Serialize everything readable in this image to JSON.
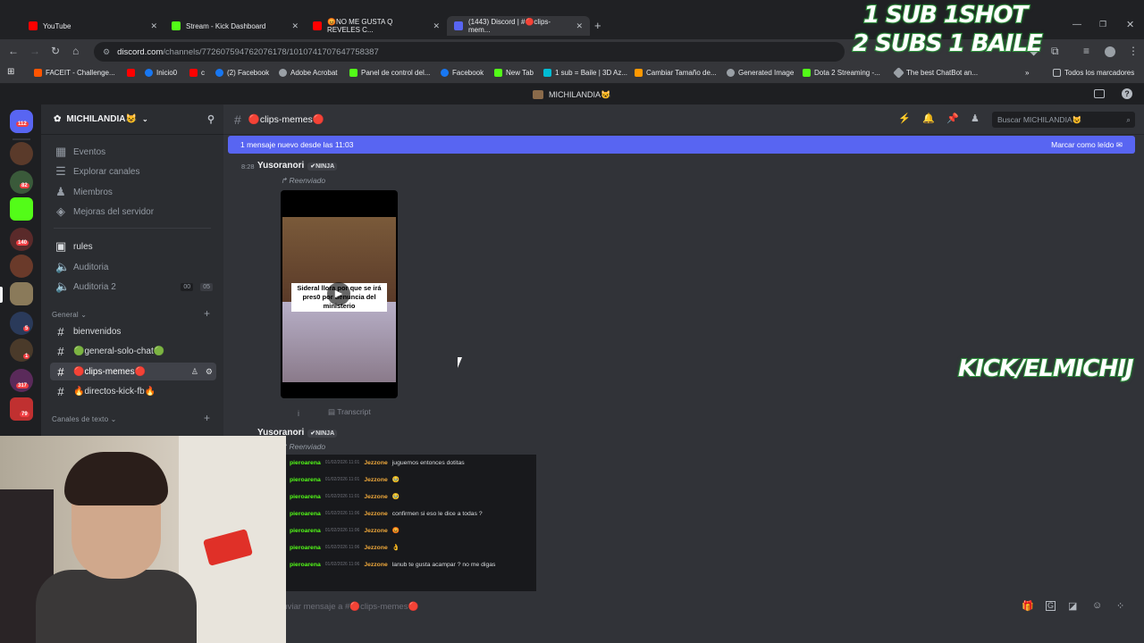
{
  "browser": {
    "tabs": [
      {
        "title": "YouTube",
        "color": "#ff0000"
      },
      {
        "title": "Stream - Kick Dashboard",
        "color": "#53fc18"
      },
      {
        "title": "😡NO ME GUSTA Q REVELES C...",
        "color": "#ff0000"
      },
      {
        "title": "(1443) Discord | #🔴clips-mem...",
        "color": "#5865f2"
      }
    ],
    "url_domain": "discord.com",
    "url_path": "/channels/772607594762076178/1010741707647758387",
    "bookmarks": [
      {
        "label": "FACEIT - Challenge...",
        "color": "#ff5500"
      },
      {
        "label": "",
        "color": "#ff0000"
      },
      {
        "label": "Inicio0",
        "color": "#1877f2"
      },
      {
        "label": "c",
        "color": "#ff0000"
      },
      {
        "label": "(2) Facebook",
        "color": "#1877f2"
      },
      {
        "label": "Adobe Acrobat",
        "color": "#9aa0a6"
      },
      {
        "label": "Panel de control del...",
        "color": "#53fc18"
      },
      {
        "label": "Facebook",
        "color": "#1877f2"
      },
      {
        "label": "New Tab",
        "color": "#53fc18"
      },
      {
        "label": "1 sub = Baile | 3D Az...",
        "color": "#00bcd4"
      },
      {
        "label": "Cambiar Tamaño de...",
        "color": "#ff9800"
      },
      {
        "label": "Generated Image",
        "color": "#9aa0a6"
      },
      {
        "label": "Dota 2 Streaming -...",
        "color": "#53fc18"
      },
      {
        "label": "The best ChatBot an...",
        "color": "#9aa0a6"
      }
    ],
    "all_bookmarks": "Todos los marcadores"
  },
  "discord": {
    "window_title": "MICHILANDIA😺",
    "server_name": "MICHILANDIA😺",
    "server_badges": [
      "112",
      "82",
      "140",
      "5",
      "1",
      "317",
      "79"
    ],
    "menu_items": [
      "Eventos",
      "Explorar canales",
      "Miembros",
      "Mejoras del servidor"
    ],
    "top_channels": [
      {
        "name": "rules",
        "type": "rules"
      },
      {
        "name": "Auditoria",
        "type": "voice"
      },
      {
        "name": "Auditoria 2",
        "type": "voice",
        "counts": [
          "00",
          "05"
        ]
      }
    ],
    "category_general": "General",
    "text_channels": [
      {
        "name": "bienvenidos"
      },
      {
        "name": "🟢general-solo-chat🟢"
      },
      {
        "name": "🔴clips-memes🔴"
      },
      {
        "name": "🔥directos-kick-fb🔥"
      }
    ],
    "category_text": "Canales de texto",
    "current_channel": "🔴clips-memes🔴",
    "search_placeholder": "Buscar MICHILANDIA😺",
    "new_messages_text": "1 mensaje nuevo desde las 11:03",
    "mark_read": "Marcar como leído",
    "messages": [
      {
        "time": "8:28",
        "author": "Yusoranori",
        "tag": "✔NINJA",
        "forwarded": "Reenviado",
        "video_caption": "Sideral llora por que se irá pres0 por denuncia del ministerio",
        "transcript": "Transcript"
      },
      {
        "author": "Yusoranori",
        "tag": "✔NINJA",
        "forwarded": "Reenviado"
      }
    ],
    "chat_rows": [
      {
        "user": "pieroarena",
        "time": "01/02/2026 11:01",
        "user2": "Jezzone",
        "text": "juguemos entonces dotitas"
      },
      {
        "user": "pieroarena",
        "time": "01/02/2026 11:01",
        "user2": "Jezzone",
        "text": "🥹"
      },
      {
        "user": "pieroarena",
        "time": "01/02/2026 11:01",
        "user2": "Jezzone",
        "text": "🥹"
      },
      {
        "user": "pieroarena",
        "time": "01/02/2026 11:06",
        "user2": "Jezzone",
        "text": "confirmen si eso le dice a todas ?"
      },
      {
        "user": "pieroarena",
        "time": "01/02/2026 11:06",
        "user2": "Jezzone",
        "text": "😡"
      },
      {
        "user": "pieroarena",
        "time": "01/02/2026 11:06",
        "user2": "Jezzone",
        "text": "👌"
      },
      {
        "user": "pieroarena",
        "time": "01/02/2026 11:06",
        "user2": "Jezzone",
        "text": "lanub te gusta acampar ? no me digas"
      }
    ],
    "input_placeholder": "Enviar mensaje a #🔴clips-memes🔴"
  },
  "overlay": {
    "line1": "1 SUB 1SHOT",
    "line2": "2 SUBS 1 BAILE",
    "kick": "KICK/ELMICHIJ"
  }
}
